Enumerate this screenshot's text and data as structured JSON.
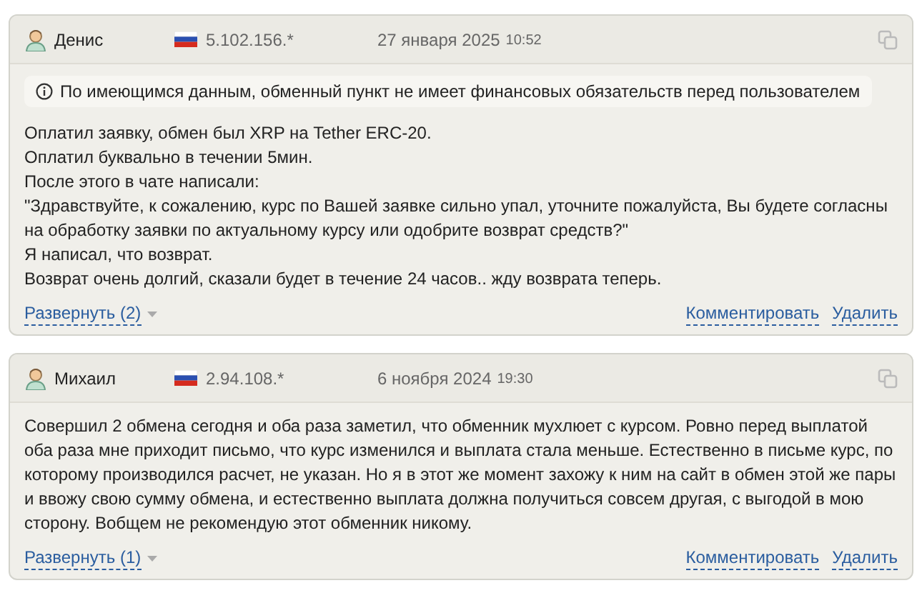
{
  "reviews": [
    {
      "author": "Денис",
      "ip": "5.102.156.*",
      "date": "27 января 2025",
      "time": "10:52",
      "notice": "По имеющимся данным, обменный пункт не имеет финансовых обязательств перед пользователем",
      "lines": [
        "Оплатил заявку, обмен был XRP на Tether ERC-20.",
        "Оплатил буквально в течении 5мин.",
        "После этого в чате написали:",
        "\"Здравствуйте, к сожалению, курс по Вашей заявке сильно упал, уточните пожалуйста, Вы будете согласны на обработку заявки по актуальному курсу или одобрите возврат средств?\"",
        "Я написал, что возврат.",
        "Возврат очень долгий, сказали будет в течение 24 часов.. жду возврата теперь."
      ],
      "expand": "Развернуть (2)",
      "actions": [
        "Комментировать",
        "Удалить"
      ]
    },
    {
      "author": "Михаил",
      "ip": "2.94.108.*",
      "date": "6 ноября 2024",
      "time": "19:30",
      "lines": [
        "Совершил 2 обмена сегодня и оба раза заметил, что обменник мухлюет с курсом. Ровно перед выплатой оба раза мне приходит письмо, что курс изменился и выплата стала меньше. Естественно в письме курс, по которому производился расчет, не указан. Но я в этот же момент захожу к ним на сайт в обмен этой же пары и ввожу свою сумму обмена, и естественно выплата должна получиться совсем другая, с выгодой в мою сторону. Вобщем не рекомендую этот обменник никому."
      ],
      "expand": "Развернуть (1)",
      "actions": [
        "Комментировать",
        "Удалить"
      ]
    }
  ]
}
